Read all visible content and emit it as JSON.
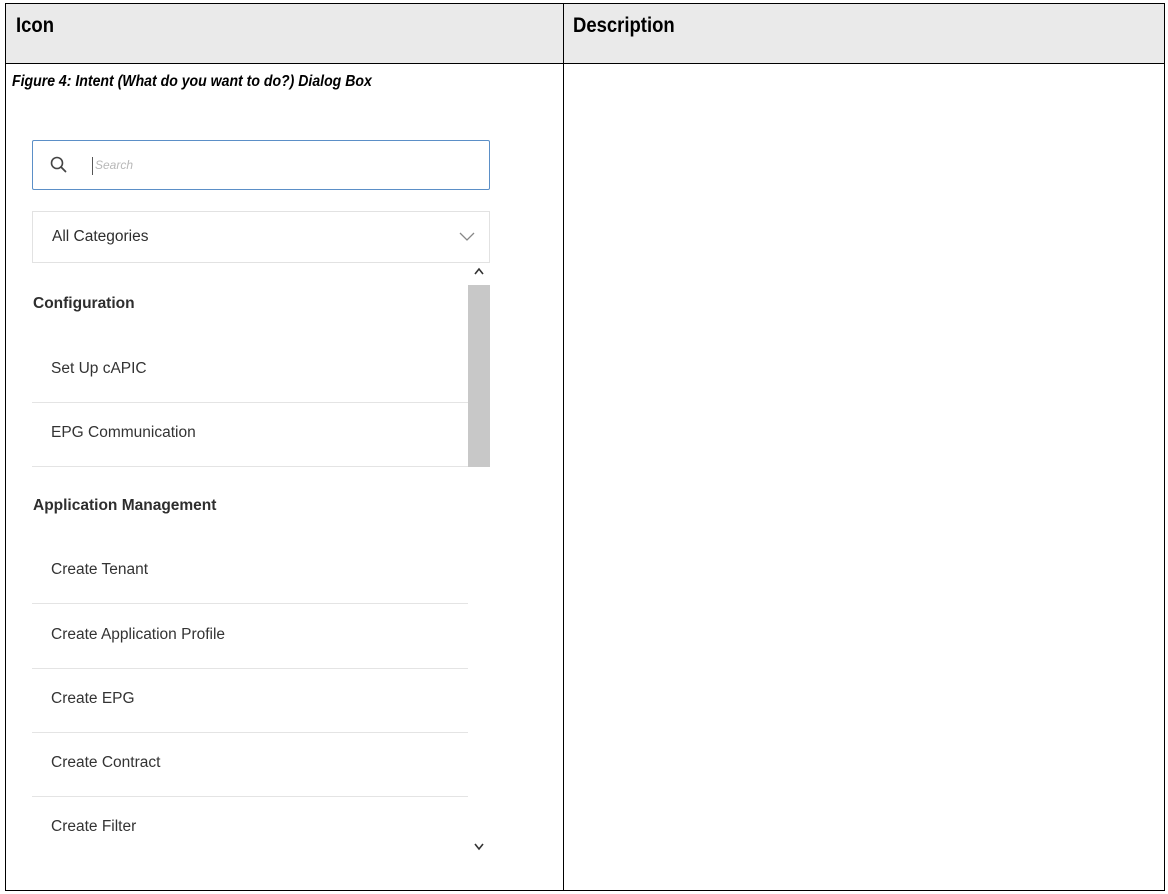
{
  "table": {
    "headers": [
      "Icon",
      "Description"
    ],
    "caption": "Figure 4: Intent (What do you want to do?) Dialog Box"
  },
  "dialog": {
    "search": {
      "placeholder": "Search",
      "icon": "search-icon"
    },
    "category_select": {
      "selected": "All Categories",
      "icon": "chevron-down-icon"
    },
    "sections": [
      {
        "title": "Configuration",
        "items": [
          "Set Up cAPIC",
          "EPG Communication"
        ]
      },
      {
        "title": "Application Management",
        "items": [
          "Create Tenant",
          "Create Application Profile",
          "Create EPG",
          "Create Contract",
          "Create Filter"
        ]
      }
    ]
  },
  "colors": {
    "header_bg": "#eaeaea",
    "search_border": "#5b8fc7",
    "scroll_thumb": "#c8c8c8"
  }
}
